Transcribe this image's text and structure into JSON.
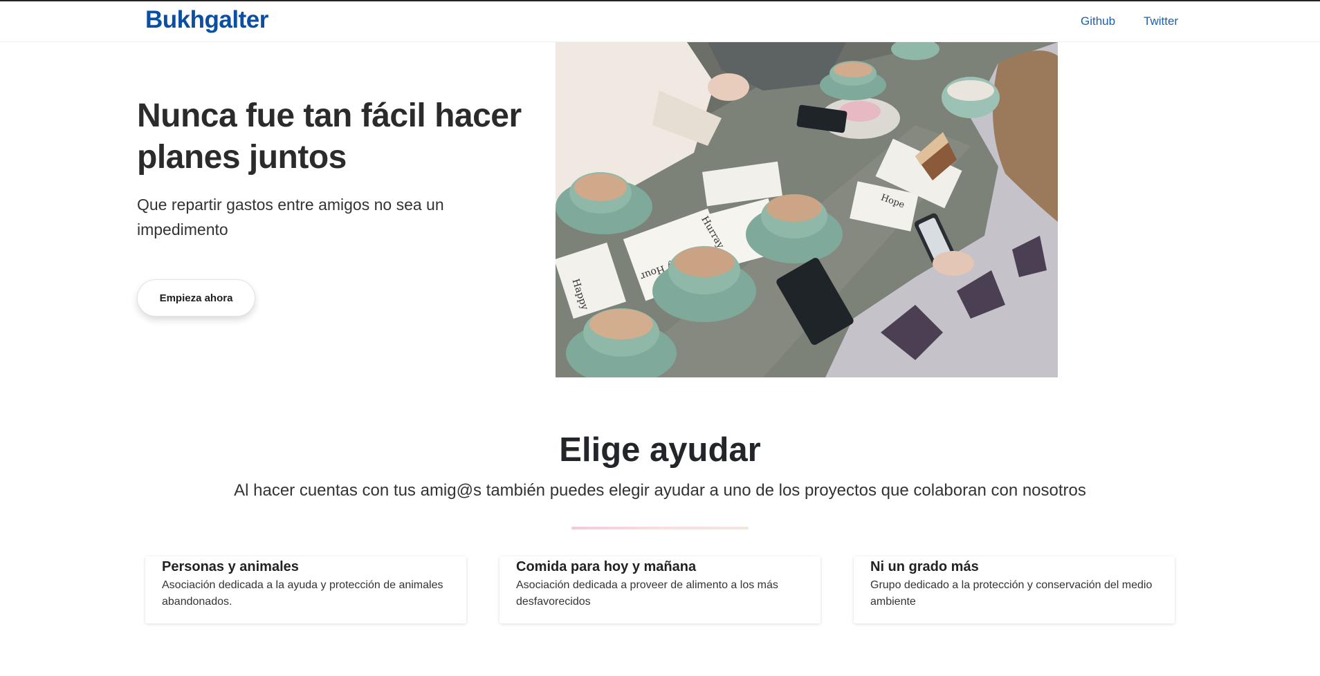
{
  "navbar": {
    "brand": "Bukhgalter",
    "links": [
      {
        "label": "Github"
      },
      {
        "label": "Twitter"
      }
    ]
  },
  "hero": {
    "title": "Nunca fue tan fácil hacer planes juntos",
    "subtitle": "Que repartir gastos entre amigos no sea un impedimento",
    "cta_label": "Empieza ahora",
    "image_cards": [
      "Happy",
      "Happy Hour",
      "Hurray",
      "Hope"
    ]
  },
  "section": {
    "title": "Elige ayudar",
    "subtitle": "Al hacer cuentas con tus amig@s también puedes elegir ayudar a uno de los proyectos que colaboran con nosotros"
  },
  "projects": [
    {
      "title": "Personas y animales",
      "description": "Asociación dedicada a la ayuda y protección de animales abandonados."
    },
    {
      "title": "Comida para hoy y mañana",
      "description": "Asociación dedicada a proveer de alimento a los más desfavorecidos"
    },
    {
      "title": "Ni un grado más",
      "description": "Grupo dedicado a la protección y conservación del medio ambiente"
    }
  ],
  "colors": {
    "brand": "#0b4fa3",
    "link": "#1b5fae",
    "cup": "#8fb8a8",
    "divider": "#f6c9d4"
  }
}
